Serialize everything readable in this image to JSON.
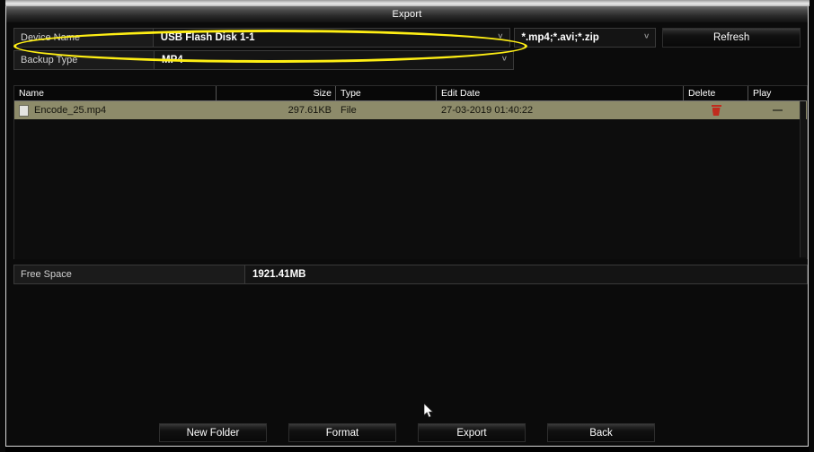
{
  "window": {
    "title": "Export"
  },
  "form": {
    "device_name": {
      "label": "Device Name",
      "value": "USB Flash Disk 1-1",
      "chevron": "˅"
    },
    "file_filter": {
      "value": "*.mp4;*.avi;*.zip",
      "chevron": "˅"
    },
    "refresh_button": "Refresh",
    "backup_type": {
      "label": "Backup Type",
      "value": "MP4",
      "chevron": "˅"
    }
  },
  "file_table": {
    "columns": [
      "Name",
      "Size",
      "Type",
      "Edit Date",
      "Delete",
      "Play"
    ],
    "rows": [
      {
        "name": "Encode_25.mp4",
        "size": "297.61KB",
        "type": "File",
        "edit_date": "27-03-2019 01:40:22",
        "delete_icon": "trash-icon",
        "play_icon": "dash-icon"
      }
    ]
  },
  "free_space": {
    "label": "Free Space",
    "value": "1921.41MB"
  },
  "buttons": {
    "new_folder": "New Folder",
    "format": "Format",
    "export": "Export",
    "back": "Back"
  },
  "annotation": {
    "shape": "ellipse-highlight",
    "color": "#ffef14",
    "target": "Device Name row"
  },
  "colors": {
    "highlight_row": "#8d8b6a",
    "delete_icon": "#c12b1e",
    "annotation": "#ffef14"
  }
}
